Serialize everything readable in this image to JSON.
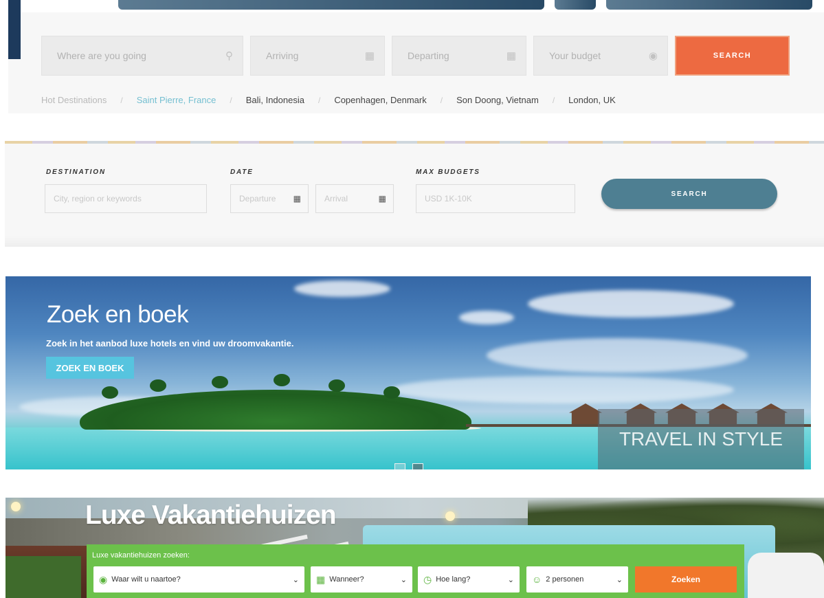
{
  "panel1": {
    "fields": [
      {
        "placeholder": "Where are you going",
        "icon": "location-pin-icon"
      },
      {
        "placeholder": "Arriving",
        "icon": "calendar-icon"
      },
      {
        "placeholder": "Departing",
        "icon": "calendar-icon"
      },
      {
        "placeholder": "Your budget",
        "icon": "dollar-icon"
      }
    ],
    "search_label": "SEARCH",
    "hot_label": "Hot Destinations",
    "destinations": [
      "Saint Pierre, France",
      "Bali, Indonesia",
      "Copenhagen, Denmark",
      "Son Doong, Vietnam",
      "London, UK"
    ],
    "accent": "#ed6a41"
  },
  "panel2": {
    "labels": {
      "destination": "DESTINATION",
      "date": "DATE",
      "budget": "MAX BUDGETS"
    },
    "destination_placeholder": "City, region or keywords",
    "departure_placeholder": "Departure",
    "arrival_placeholder": "Arrival",
    "budget_placeholder": "USD 1K-10K",
    "search_label": "SEARCH",
    "accent": "#4e7f92"
  },
  "panel3": {
    "title": "Zoek en boek",
    "subtitle": "Zoek in het aanbod luxe hotels en vind uw droomvakantie.",
    "button_label": "ZOEK EN BOEK",
    "overlay_text": "TRAVEL IN STYLE",
    "accent": "#56c4df"
  },
  "panel4": {
    "title": "Luxe Vakantiehuizen",
    "search_title": "Luxe vakantiehuizen zoeken:",
    "destination": "Waar wilt u naartoe?",
    "when": "Wanneer?",
    "duration": "Hoe lang?",
    "persons": "2 personen",
    "search_label": "Zoeken",
    "bar_color": "#6cc14b",
    "button_color": "#f1772b"
  }
}
